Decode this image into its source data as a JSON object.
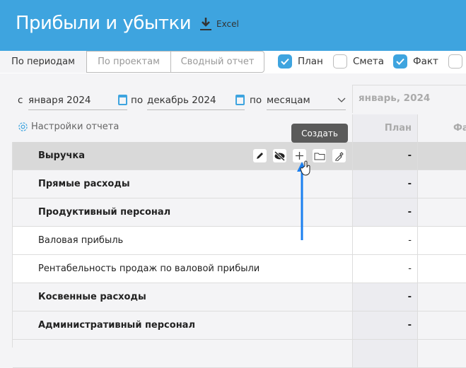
{
  "header": {
    "title": "Прибыли и убытки",
    "excel_label": "Excel"
  },
  "tabs": [
    {
      "label": "По периодам",
      "active": true
    },
    {
      "label": "По проектам"
    },
    {
      "label": "Сводный отчет"
    }
  ],
  "checkboxes": [
    {
      "label": "План",
      "checked": true
    },
    {
      "label": "Смета",
      "checked": false
    },
    {
      "label": "Факт",
      "checked": true
    },
    {
      "label": "",
      "checked": false
    }
  ],
  "filters": {
    "from_prefix": "с",
    "from_value": "января 2024",
    "to_prefix": "по",
    "to_value": "декабрь 2024",
    "by_prefix": "по",
    "by_value": "месяцам"
  },
  "settings_label": "Настройки отчета",
  "period_header": "январь, 2024",
  "columns": {
    "plan": "План",
    "fact": "Факт"
  },
  "tooltip": "Создать",
  "rows": [
    {
      "label": "Выручка",
      "plan": "-"
    },
    {
      "label": "Прямые расходы",
      "plan": "-"
    },
    {
      "label": "Продуктивный персонал",
      "plan": "-"
    },
    {
      "label": "Валовая прибыль",
      "plan": "-"
    },
    {
      "label": "Рентабельность продаж по валовой прибыли",
      "plan": "-"
    },
    {
      "label": "Косвенные расходы",
      "plan": "-"
    },
    {
      "label": "Административный персонал",
      "plan": "-"
    },
    {
      "label": "",
      "plan": ""
    }
  ]
}
